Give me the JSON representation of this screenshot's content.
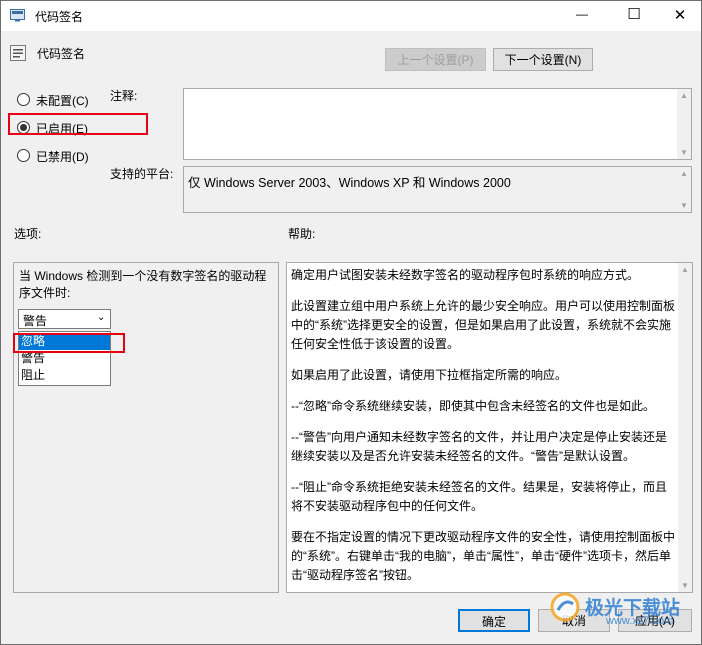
{
  "window": {
    "title": "代码签名",
    "minimize": "—",
    "maximize": "☐",
    "close": "✕"
  },
  "header": {
    "policy_name": "代码签名",
    "prev_button": "上一个设置(P)",
    "next_button": "下一个设置(N)"
  },
  "state": {
    "options": [
      {
        "label": "未配置(C)",
        "selected": false
      },
      {
        "label": "已启用(E)",
        "selected": true
      },
      {
        "label": "已禁用(D)",
        "selected": false
      }
    ]
  },
  "comment": {
    "label": "注释:",
    "value": ""
  },
  "platform": {
    "label": "支持的平台:",
    "value": "仅 Windows Server 2003、Windows XP 和 Windows 2000"
  },
  "options_panel": {
    "title": "选项:",
    "description": "当 Windows 检测到一个没有数字签名的驱动程序文件时:",
    "dropdown": {
      "selected": "警告",
      "items": [
        "忽略",
        "警告",
        "阻止"
      ],
      "highlighted_index": 0
    }
  },
  "help_panel": {
    "title": "帮助:",
    "paragraphs": [
      "确定用户试图安装未经数字签名的驱动程序包时系统的响应方式。",
      "此设置建立组中用户系统上允许的最少安全响应。用户可以使用控制面板中的“系统”选择更安全的设置，但是如果启用了此设置，系统就不会实施任何安全性低于该设置的设置。",
      "如果启用了此设置，请使用下拉框指定所需的响应。",
      "--“忽略”命令系统继续安装，即使其中包含未经签名的文件也是如此。",
      "--“警告”向用户通知未经数字签名的文件，并让用户决定是停止安装还是继续安装以及是否允许安装未经签名的文件。“警告”是默认设置。",
      "--“阻止”命令系统拒绝安装未经签名的文件。结果是，安装将停止，而且将不安装驱动程序包中的任何文件。",
      "要在不指定设置的情况下更改驱动程序文件的安全性，请使用控制面板中的“系统”。右键单击“我的电脑”，单击“属性”，单击“硬件”选项卡，然后单击“驱动程序签名”按钮。"
    ]
  },
  "footer": {
    "ok": "确定",
    "cancel": "取消",
    "apply": "应用(A)"
  },
  "watermark": {
    "text": "极光下载站",
    "url": "www.xz7.com"
  },
  "colors": {
    "highlight": "#0078d7",
    "annotation_red": "#e60012"
  }
}
